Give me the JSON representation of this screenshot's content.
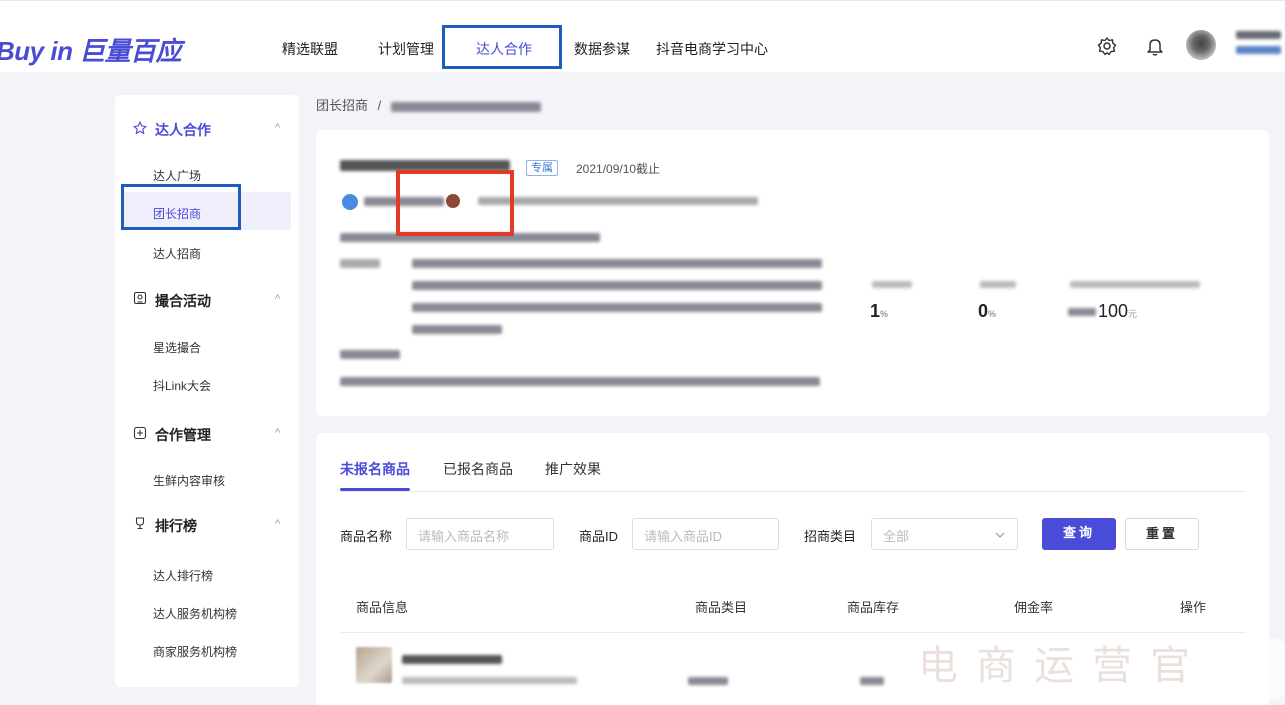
{
  "header": {
    "logo": "Buy in 巨量百应",
    "nav": [
      "精选联盟",
      "计划管理",
      "达人合作",
      "数据参谋",
      "抖音电商学习中心"
    ],
    "active_nav": "达人合作"
  },
  "sidebar": {
    "sections": [
      {
        "title": "达人合作",
        "icon": "star-icon",
        "items": [
          "达人广场",
          "团长招商",
          "达人招商"
        ]
      },
      {
        "title": "撮合活动",
        "icon": "activity-icon",
        "items": [
          "星选撮合",
          "抖Link大会"
        ]
      },
      {
        "title": "合作管理",
        "icon": "manage-icon",
        "items": [
          "生鲜内容审核"
        ]
      },
      {
        "title": "排行榜",
        "icon": "trophy-icon",
        "items": [
          "达人排行榜",
          "达人服务机构榜",
          "商家服务机构榜"
        ]
      }
    ],
    "active_item": "团长招商",
    "chevron": "^"
  },
  "breadcrumb": {
    "root": "团长招商",
    "separator": "/"
  },
  "activity": {
    "tag": "专属",
    "deadline": "2021/09/10截止",
    "stats": [
      {
        "value": "1",
        "unit": "%"
      },
      {
        "value": "0",
        "unit": "%"
      },
      {
        "value": "100",
        "unit": "元"
      }
    ]
  },
  "products": {
    "tabs": [
      "未报名商品",
      "已报名商品",
      "推广效果"
    ],
    "active_tab": "未报名商品",
    "filters": {
      "name_label": "商品名称",
      "name_placeholder": "请输入商品名称",
      "id_label": "商品ID",
      "id_placeholder": "请输入商品ID",
      "category_label": "招商类目",
      "category_value": "全部"
    },
    "buttons": {
      "query": "查询",
      "reset": "重置"
    },
    "columns": [
      "商品信息",
      "商品类目",
      "商品库存",
      "佣金率",
      "操作"
    ]
  },
  "watermark": "电商运营官",
  "colors": {
    "accent": "#4a4bd8",
    "highlight_blue": "#1f5dbd",
    "highlight_red": "#e03a2b"
  }
}
